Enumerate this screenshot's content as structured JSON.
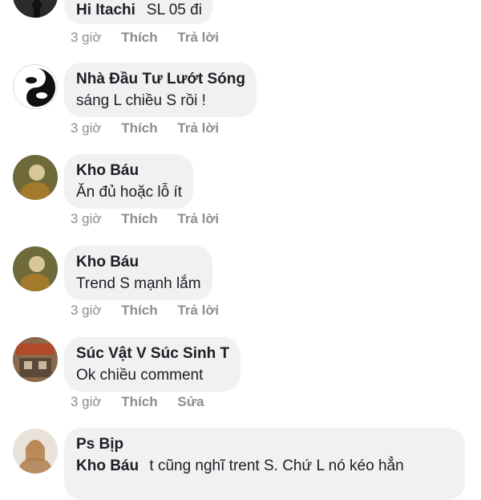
{
  "comments": [
    {
      "author": "Hi Itachi",
      "text": "SL 05 đi",
      "time": "3 giờ",
      "action1": "Thích",
      "action2": "Trả lời"
    },
    {
      "author": "Nhà Đầu Tư Lướt Sóng",
      "text": "sáng L chiều S rồi !",
      "time": "3 giờ",
      "action1": "Thích",
      "action2": "Trả lời"
    },
    {
      "author": "Kho Báu",
      "text": "Ăn đủ hoặc lỗ ít",
      "time": "3 giờ",
      "action1": "Thích",
      "action2": "Trả lời"
    },
    {
      "author": "Kho Báu",
      "text": "Trend S mạnh lắm",
      "time": "3 giờ",
      "action1": "Thích",
      "action2": "Trả lời"
    },
    {
      "author": "Súc Vật V Súc Sinh T",
      "text": "Ok chiều comment",
      "time": "3 giờ",
      "action1": "Thích",
      "action2": "Sửa"
    },
    {
      "author": "Ps Bịp",
      "mention": "Kho Báu",
      "text": "t cũng nghĩ trent S. Chứ L nó kéo hẳn"
    }
  ]
}
